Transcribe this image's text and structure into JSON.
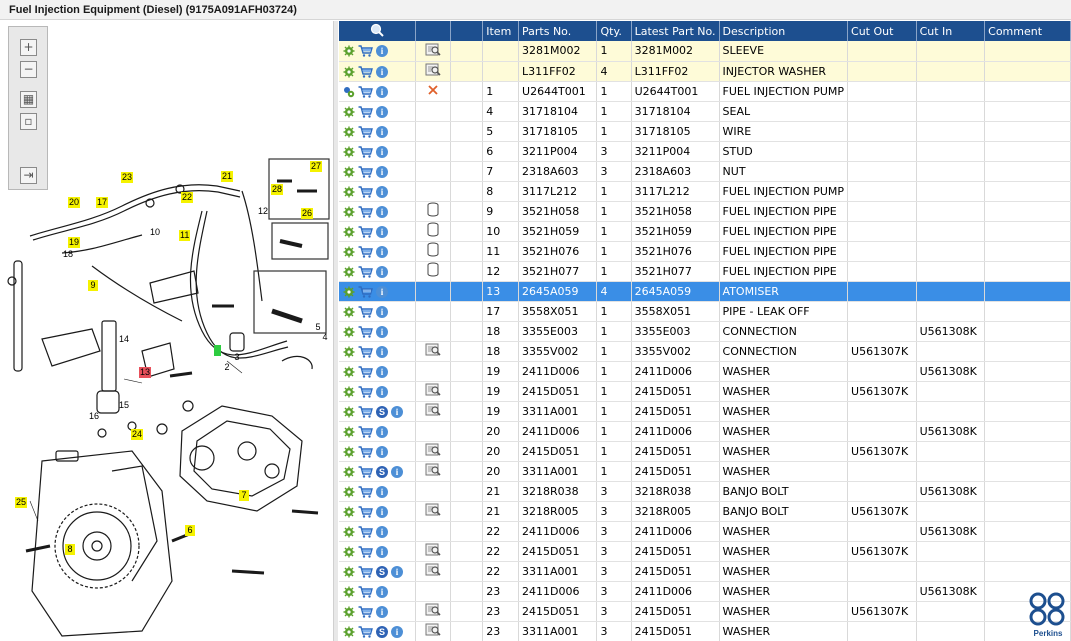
{
  "title": "Fuel Injection Equipment (Diesel) (9175A091AFH03724)",
  "zoom_toolbar": [
    {
      "name": "zoom-in-button",
      "glyph": "+"
    },
    {
      "name": "zoom-out-button",
      "glyph": "−"
    },
    {
      "name": "fit-all-button",
      "glyph": "▦"
    },
    {
      "name": "fit-window-button",
      "glyph": "▫"
    },
    {
      "name": "export-button",
      "glyph": "⇥"
    }
  ],
  "callouts": [
    "27",
    "23",
    "21",
    "28",
    "26",
    "20",
    "17",
    "22",
    "12",
    "19",
    "10",
    "11",
    "18",
    "9",
    "5",
    "4",
    "14",
    "13",
    "15",
    "16",
    "24",
    "7",
    "25",
    "6",
    "8",
    "2",
    "3",
    "1"
  ],
  "columns": {
    "item": "Item",
    "parts_no": "Parts No.",
    "qty": "Qty.",
    "latest_part_no": "Latest Part No.",
    "description": "Description",
    "cut_out": "Cut Out",
    "cut_in": "Cut In",
    "comment": "Comment"
  },
  "rows": [
    {
      "item": "",
      "parts_no": "3281M002",
      "qty": "1",
      "latest": "3281M002",
      "desc": "SLEEVE",
      "cut_out": "",
      "cut_in": "",
      "comment": "",
      "note": true,
      "s": false,
      "doc": true,
      "cancel": false,
      "cyl": false,
      "state": "note"
    },
    {
      "item": "",
      "parts_no": "L311FF02",
      "qty": "4",
      "latest": "L311FF02",
      "desc": "INJECTOR WASHER",
      "cut_out": "",
      "cut_in": "",
      "comment": "",
      "note": true,
      "s": false,
      "doc": true,
      "cancel": false,
      "cyl": false,
      "state": "note"
    },
    {
      "item": "1",
      "parts_no": "U2644T001",
      "qty": "1",
      "latest": "U2644T001",
      "desc": "FUEL INJECTION PUMP",
      "cut_out": "",
      "cut_in": "",
      "comment": "",
      "s": false,
      "doc": false,
      "cancel": true,
      "cyl": false,
      "state": ""
    },
    {
      "item": "4",
      "parts_no": "31718104",
      "qty": "1",
      "latest": "31718104",
      "desc": "SEAL",
      "cut_out": "",
      "cut_in": "",
      "comment": "",
      "s": false,
      "doc": false,
      "cancel": false,
      "cyl": false,
      "state": ""
    },
    {
      "item": "5",
      "parts_no": "31718105",
      "qty": "1",
      "latest": "31718105",
      "desc": "WIRE",
      "cut_out": "",
      "cut_in": "",
      "comment": "",
      "s": false,
      "doc": false,
      "cancel": false,
      "cyl": false,
      "state": ""
    },
    {
      "item": "6",
      "parts_no": "3211P004",
      "qty": "3",
      "latest": "3211P004",
      "desc": "STUD",
      "cut_out": "",
      "cut_in": "",
      "comment": "",
      "s": false,
      "doc": false,
      "cancel": false,
      "cyl": false,
      "state": ""
    },
    {
      "item": "7",
      "parts_no": "2318A603",
      "qty": "3",
      "latest": "2318A603",
      "desc": "NUT",
      "cut_out": "",
      "cut_in": "",
      "comment": "",
      "s": false,
      "doc": false,
      "cancel": false,
      "cyl": false,
      "state": ""
    },
    {
      "item": "8",
      "parts_no": "3117L212",
      "qty": "1",
      "latest": "3117L212",
      "desc": "FUEL INJECTION PUMP",
      "cut_out": "",
      "cut_in": "",
      "comment": "",
      "s": false,
      "doc": false,
      "cancel": false,
      "cyl": false,
      "state": ""
    },
    {
      "item": "9",
      "parts_no": "3521H058",
      "qty": "1",
      "latest": "3521H058",
      "desc": "FUEL INJECTION PIPE",
      "cut_out": "",
      "cut_in": "",
      "comment": "",
      "s": false,
      "doc": false,
      "cancel": false,
      "cyl": true,
      "state": ""
    },
    {
      "item": "10",
      "parts_no": "3521H059",
      "qty": "1",
      "latest": "3521H059",
      "desc": "FUEL INJECTION PIPE",
      "cut_out": "",
      "cut_in": "",
      "comment": "",
      "s": false,
      "doc": false,
      "cancel": false,
      "cyl": true,
      "state": ""
    },
    {
      "item": "11",
      "parts_no": "3521H076",
      "qty": "1",
      "latest": "3521H076",
      "desc": "FUEL INJECTION PIPE",
      "cut_out": "",
      "cut_in": "",
      "comment": "",
      "s": false,
      "doc": false,
      "cancel": false,
      "cyl": true,
      "state": ""
    },
    {
      "item": "12",
      "parts_no": "3521H077",
      "qty": "1",
      "latest": "3521H077",
      "desc": "FUEL INJECTION PIPE",
      "cut_out": "",
      "cut_in": "",
      "comment": "",
      "s": false,
      "doc": false,
      "cancel": false,
      "cyl": true,
      "state": ""
    },
    {
      "item": "13",
      "parts_no": "2645A059",
      "qty": "4",
      "latest": "2645A059",
      "desc": "ATOMISER",
      "cut_out": "",
      "cut_in": "",
      "comment": "",
      "s": false,
      "doc": false,
      "cancel": false,
      "cyl": false,
      "state": "sel"
    },
    {
      "item": "17",
      "parts_no": "3558X051",
      "qty": "1",
      "latest": "3558X051",
      "desc": "PIPE - LEAK OFF",
      "cut_out": "",
      "cut_in": "",
      "comment": "",
      "s": false,
      "doc": false,
      "cancel": false,
      "cyl": false,
      "state": ""
    },
    {
      "item": "18",
      "parts_no": "3355E003",
      "qty": "1",
      "latest": "3355E003",
      "desc": "CONNECTION",
      "cut_out": "",
      "cut_in": "U561308K",
      "comment": "",
      "s": false,
      "doc": false,
      "cancel": false,
      "cyl": false,
      "state": ""
    },
    {
      "item": "18",
      "parts_no": "3355V002",
      "qty": "1",
      "latest": "3355V002",
      "desc": "CONNECTION",
      "cut_out": "U561307K",
      "cut_in": "",
      "comment": "",
      "s": false,
      "doc": true,
      "cancel": false,
      "cyl": false,
      "state": ""
    },
    {
      "item": "19",
      "parts_no": "2411D006",
      "qty": "1",
      "latest": "2411D006",
      "desc": "WASHER",
      "cut_out": "",
      "cut_in": "U561308K",
      "comment": "",
      "s": false,
      "doc": false,
      "cancel": false,
      "cyl": false,
      "state": ""
    },
    {
      "item": "19",
      "parts_no": "2415D051",
      "qty": "1",
      "latest": "2415D051",
      "desc": "WASHER",
      "cut_out": "U561307K",
      "cut_in": "",
      "comment": "",
      "s": false,
      "doc": true,
      "cancel": false,
      "cyl": false,
      "state": ""
    },
    {
      "item": "19",
      "parts_no": "3311A001",
      "qty": "1",
      "latest": "2415D051",
      "desc": "WASHER",
      "cut_out": "",
      "cut_in": "",
      "comment": "",
      "s": true,
      "doc": true,
      "cancel": false,
      "cyl": false,
      "state": ""
    },
    {
      "item": "20",
      "parts_no": "2411D006",
      "qty": "1",
      "latest": "2411D006",
      "desc": "WASHER",
      "cut_out": "",
      "cut_in": "U561308K",
      "comment": "",
      "s": false,
      "doc": false,
      "cancel": false,
      "cyl": false,
      "state": ""
    },
    {
      "item": "20",
      "parts_no": "2415D051",
      "qty": "1",
      "latest": "2415D051",
      "desc": "WASHER",
      "cut_out": "U561307K",
      "cut_in": "",
      "comment": "",
      "s": false,
      "doc": true,
      "cancel": false,
      "cyl": false,
      "state": ""
    },
    {
      "item": "20",
      "parts_no": "3311A001",
      "qty": "1",
      "latest": "2415D051",
      "desc": "WASHER",
      "cut_out": "",
      "cut_in": "",
      "comment": "",
      "s": true,
      "doc": true,
      "cancel": false,
      "cyl": false,
      "state": ""
    },
    {
      "item": "21",
      "parts_no": "3218R038",
      "qty": "3",
      "latest": "3218R038",
      "desc": "BANJO BOLT",
      "cut_out": "",
      "cut_in": "U561308K",
      "comment": "",
      "s": false,
      "doc": false,
      "cancel": false,
      "cyl": false,
      "state": ""
    },
    {
      "item": "21",
      "parts_no": "3218R005",
      "qty": "3",
      "latest": "3218R005",
      "desc": "BANJO BOLT",
      "cut_out": "U561307K",
      "cut_in": "",
      "comment": "",
      "s": false,
      "doc": true,
      "cancel": false,
      "cyl": false,
      "state": ""
    },
    {
      "item": "22",
      "parts_no": "2411D006",
      "qty": "3",
      "latest": "2411D006",
      "desc": "WASHER",
      "cut_out": "",
      "cut_in": "U561308K",
      "comment": "",
      "s": false,
      "doc": false,
      "cancel": false,
      "cyl": false,
      "state": ""
    },
    {
      "item": "22",
      "parts_no": "2415D051",
      "qty": "3",
      "latest": "2415D051",
      "desc": "WASHER",
      "cut_out": "U561307K",
      "cut_in": "",
      "comment": "",
      "s": false,
      "doc": true,
      "cancel": false,
      "cyl": false,
      "state": ""
    },
    {
      "item": "22",
      "parts_no": "3311A001",
      "qty": "3",
      "latest": "2415D051",
      "desc": "WASHER",
      "cut_out": "",
      "cut_in": "",
      "comment": "",
      "s": true,
      "doc": true,
      "cancel": false,
      "cyl": false,
      "state": ""
    },
    {
      "item": "23",
      "parts_no": "2411D006",
      "qty": "3",
      "latest": "2411D006",
      "desc": "WASHER",
      "cut_out": "",
      "cut_in": "U561308K",
      "comment": "",
      "s": false,
      "doc": false,
      "cancel": false,
      "cyl": false,
      "state": ""
    },
    {
      "item": "23",
      "parts_no": "2415D051",
      "qty": "3",
      "latest": "2415D051",
      "desc": "WASHER",
      "cut_out": "U561307K",
      "cut_in": "",
      "comment": "",
      "s": false,
      "doc": true,
      "cancel": false,
      "cyl": false,
      "state": ""
    },
    {
      "item": "23",
      "parts_no": "3311A001",
      "qty": "3",
      "latest": "2415D051",
      "desc": "WASHER",
      "cut_out": "",
      "cut_in": "",
      "comment": "",
      "s": true,
      "doc": true,
      "cancel": false,
      "cyl": false,
      "state": ""
    }
  ],
  "logo_text": "Perkins",
  "colors": {
    "header_bg": "#1d4f8f",
    "selected_row": "#3a8ee6",
    "note_row": "#fefbd8",
    "callout_yellow": "#f5f200",
    "callout_red": "#e8505b",
    "gear_green": "#5aa02c",
    "cart_blue": "#2f6cc0"
  }
}
